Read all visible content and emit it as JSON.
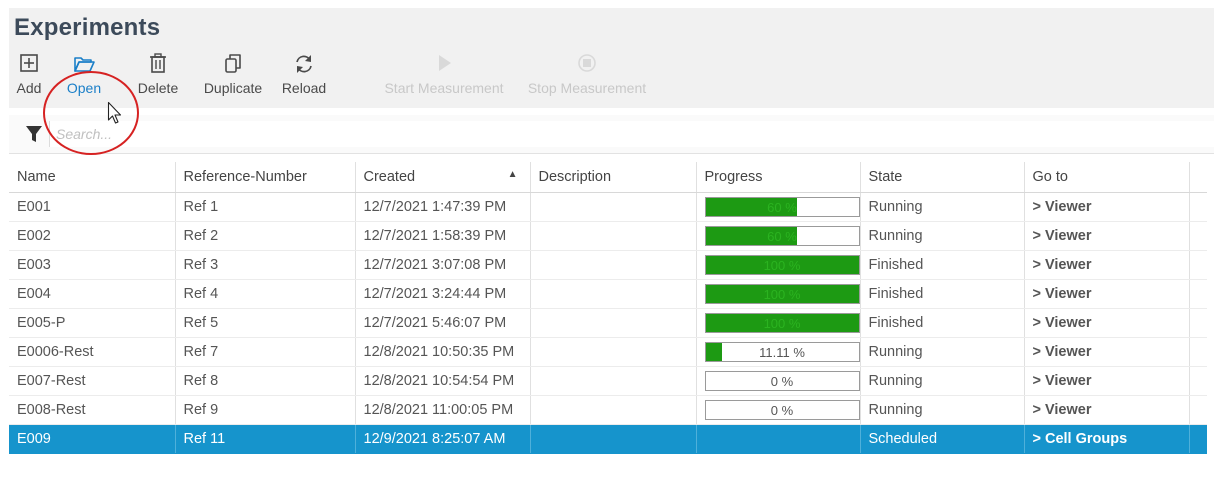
{
  "window": {
    "title": "Experiments"
  },
  "toolbar": {
    "add": "Add",
    "open": "Open",
    "delete": "Delete",
    "duplicate": "Duplicate",
    "reload": "Reload",
    "start": "Start Measurement",
    "stop": "Stop Measurement"
  },
  "search": {
    "placeholder": "Search..."
  },
  "table": {
    "columns": [
      "Name",
      "Reference-Number",
      "Created",
      "Description",
      "Progress",
      "State",
      "Go to"
    ],
    "sort_column": "Created",
    "rows": [
      {
        "name": "E001",
        "ref": "Ref 1",
        "created": "12/7/2021 1:47:39 PM",
        "description": "",
        "progress": 0.6,
        "progress_label": "60 %",
        "state": "Running",
        "goto": "> Viewer"
      },
      {
        "name": "E002",
        "ref": "Ref 2",
        "created": "12/7/2021 1:58:39 PM",
        "description": "",
        "progress": 0.6,
        "progress_label": "60 %",
        "state": "Running",
        "goto": "> Viewer"
      },
      {
        "name": "E003",
        "ref": "Ref 3",
        "created": "12/7/2021 3:07:08 PM",
        "description": "",
        "progress": 1.0,
        "progress_label": "100 %",
        "state": "Finished",
        "goto": "> Viewer"
      },
      {
        "name": "E004",
        "ref": "Ref 4",
        "created": "12/7/2021 3:24:44 PM",
        "description": "",
        "progress": 1.0,
        "progress_label": "100 %",
        "state": "Finished",
        "goto": "> Viewer"
      },
      {
        "name": "E005-P",
        "ref": "Ref 5",
        "created": "12/7/2021 5:46:07 PM",
        "description": "",
        "progress": 1.0,
        "progress_label": "100 %",
        "state": "Finished",
        "goto": "> Viewer"
      },
      {
        "name": "E0006-Rest",
        "ref": "Ref 7",
        "created": "12/8/2021 10:50:35 PM",
        "description": "",
        "progress": 0.1111,
        "progress_label": "11.11 %",
        "state": "Running",
        "goto": "> Viewer"
      },
      {
        "name": "E007-Rest",
        "ref": "Ref 8",
        "created": "12/8/2021 10:54:54 PM",
        "description": "",
        "progress": 0,
        "progress_label": "0 %",
        "state": "Running",
        "goto": "> Viewer"
      },
      {
        "name": "E008-Rest",
        "ref": "Ref 9",
        "created": "12/8/2021 11:00:05 PM",
        "description": "",
        "progress": 0,
        "progress_label": "0 %",
        "state": "Running",
        "goto": "> Viewer"
      },
      {
        "name": "E009",
        "ref": "Ref 11",
        "created": "12/9/2021 8:25:07 AM",
        "description": "",
        "progress": null,
        "progress_label": "",
        "state": "Scheduled",
        "goto": "> Cell Groups",
        "selected": true
      }
    ]
  },
  "colors": {
    "accent": "#1a7fc8",
    "selection": "#1694cc",
    "progress_fill": "#1d9a13",
    "link": "#1b6aa8",
    "annotation_circle": "#d62222"
  },
  "icons": {
    "add": "add-icon",
    "open": "folder-open-icon",
    "delete": "trash-icon",
    "duplicate": "duplicate-icon",
    "reload": "reload-icon",
    "start": "play-icon",
    "stop": "stop-icon",
    "filter": "filter-icon",
    "cursor": "mouse-cursor-icon"
  }
}
